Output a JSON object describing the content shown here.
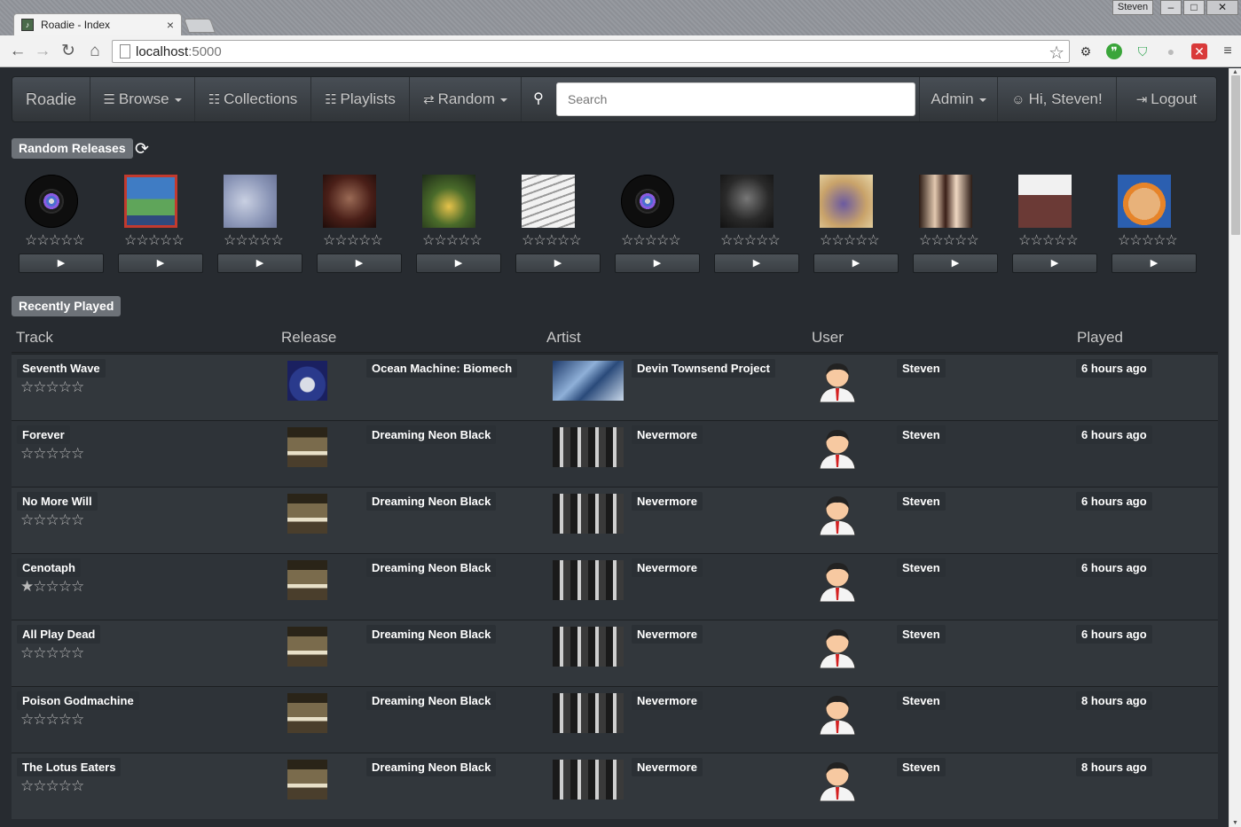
{
  "browser": {
    "tab_title": "Roadie - Index",
    "tab_close": "×",
    "url_host": "localhost",
    "url_port": ":5000",
    "window_user": "Steven",
    "win_min": "–",
    "win_max": "□",
    "win_close": "✕"
  },
  "navbar": {
    "brand": "Roadie",
    "browse": "Browse",
    "collections": "Collections",
    "playlists": "Playlists",
    "random": "Random",
    "search_placeholder": "Search",
    "admin": "Admin",
    "greeting": "Hi, Steven!",
    "logout": "Logout"
  },
  "random_releases": {
    "heading": "Random Releases",
    "items": [
      {
        "cover": "vinyl-placeholder",
        "rating": "☆☆☆☆☆",
        "play": "▶"
      },
      {
        "cover": "blue-red-album",
        "rating": "☆☆☆☆☆",
        "play": "▶"
      },
      {
        "cover": "pale-blue-album",
        "rating": "☆☆☆☆☆",
        "play": "▶"
      },
      {
        "cover": "dark-red-album",
        "rating": "☆☆☆☆☆",
        "play": "▶"
      },
      {
        "cover": "alter-bridge-album",
        "rating": "☆☆☆☆☆",
        "play": "▶"
      },
      {
        "cover": "white-z-album",
        "rating": "☆☆☆☆☆",
        "play": "▶"
      },
      {
        "cover": "vinyl-placeholder",
        "rating": "☆☆☆☆☆",
        "play": "▶"
      },
      {
        "cover": "dark-portrait-album",
        "rating": "☆☆☆☆☆",
        "play": "▶"
      },
      {
        "cover": "los-lobos-album",
        "rating": "☆☆☆☆☆",
        "play": "▶"
      },
      {
        "cover": "group-photo-album",
        "rating": "☆☆☆☆☆",
        "play": "▶"
      },
      {
        "cover": "some-nights-album",
        "rating": "☆☆☆☆☆",
        "play": "▶"
      },
      {
        "cover": "cartoon-face-album",
        "rating": "☆☆☆☆☆",
        "play": "▶"
      }
    ]
  },
  "recently_played": {
    "heading": "Recently Played",
    "columns": [
      "Track",
      "Release",
      "Artist",
      "User",
      "Played"
    ],
    "rows": [
      {
        "track": "Seventh Wave",
        "rating": "☆☆☆☆☆",
        "release": "Ocean Machine: Biomech",
        "artist": "Devin Townsend Project",
        "user": "Steven",
        "played": "6 hours ago"
      },
      {
        "track": "Forever",
        "rating": "☆☆☆☆☆",
        "release": "Dreaming Neon Black",
        "artist": "Nevermore",
        "user": "Steven",
        "played": "6 hours ago"
      },
      {
        "track": "No More Will",
        "rating": "☆☆☆☆☆",
        "release": "Dreaming Neon Black",
        "artist": "Nevermore",
        "user": "Steven",
        "played": "6 hours ago"
      },
      {
        "track": "Cenotaph",
        "rating": "★☆☆☆☆",
        "release": "Dreaming Neon Black",
        "artist": "Nevermore",
        "user": "Steven",
        "played": "6 hours ago"
      },
      {
        "track": "All Play Dead",
        "rating": "☆☆☆☆☆",
        "release": "Dreaming Neon Black",
        "artist": "Nevermore",
        "user": "Steven",
        "played": "6 hours ago"
      },
      {
        "track": "Poison Godmachine",
        "rating": "☆☆☆☆☆",
        "release": "Dreaming Neon Black",
        "artist": "Nevermore",
        "user": "Steven",
        "played": "8 hours ago"
      },
      {
        "track": "The Lotus Eaters",
        "rating": "☆☆☆☆☆",
        "release": "Dreaming Neon Black",
        "artist": "Nevermore",
        "user": "Steven",
        "played": "8 hours ago"
      }
    ]
  }
}
